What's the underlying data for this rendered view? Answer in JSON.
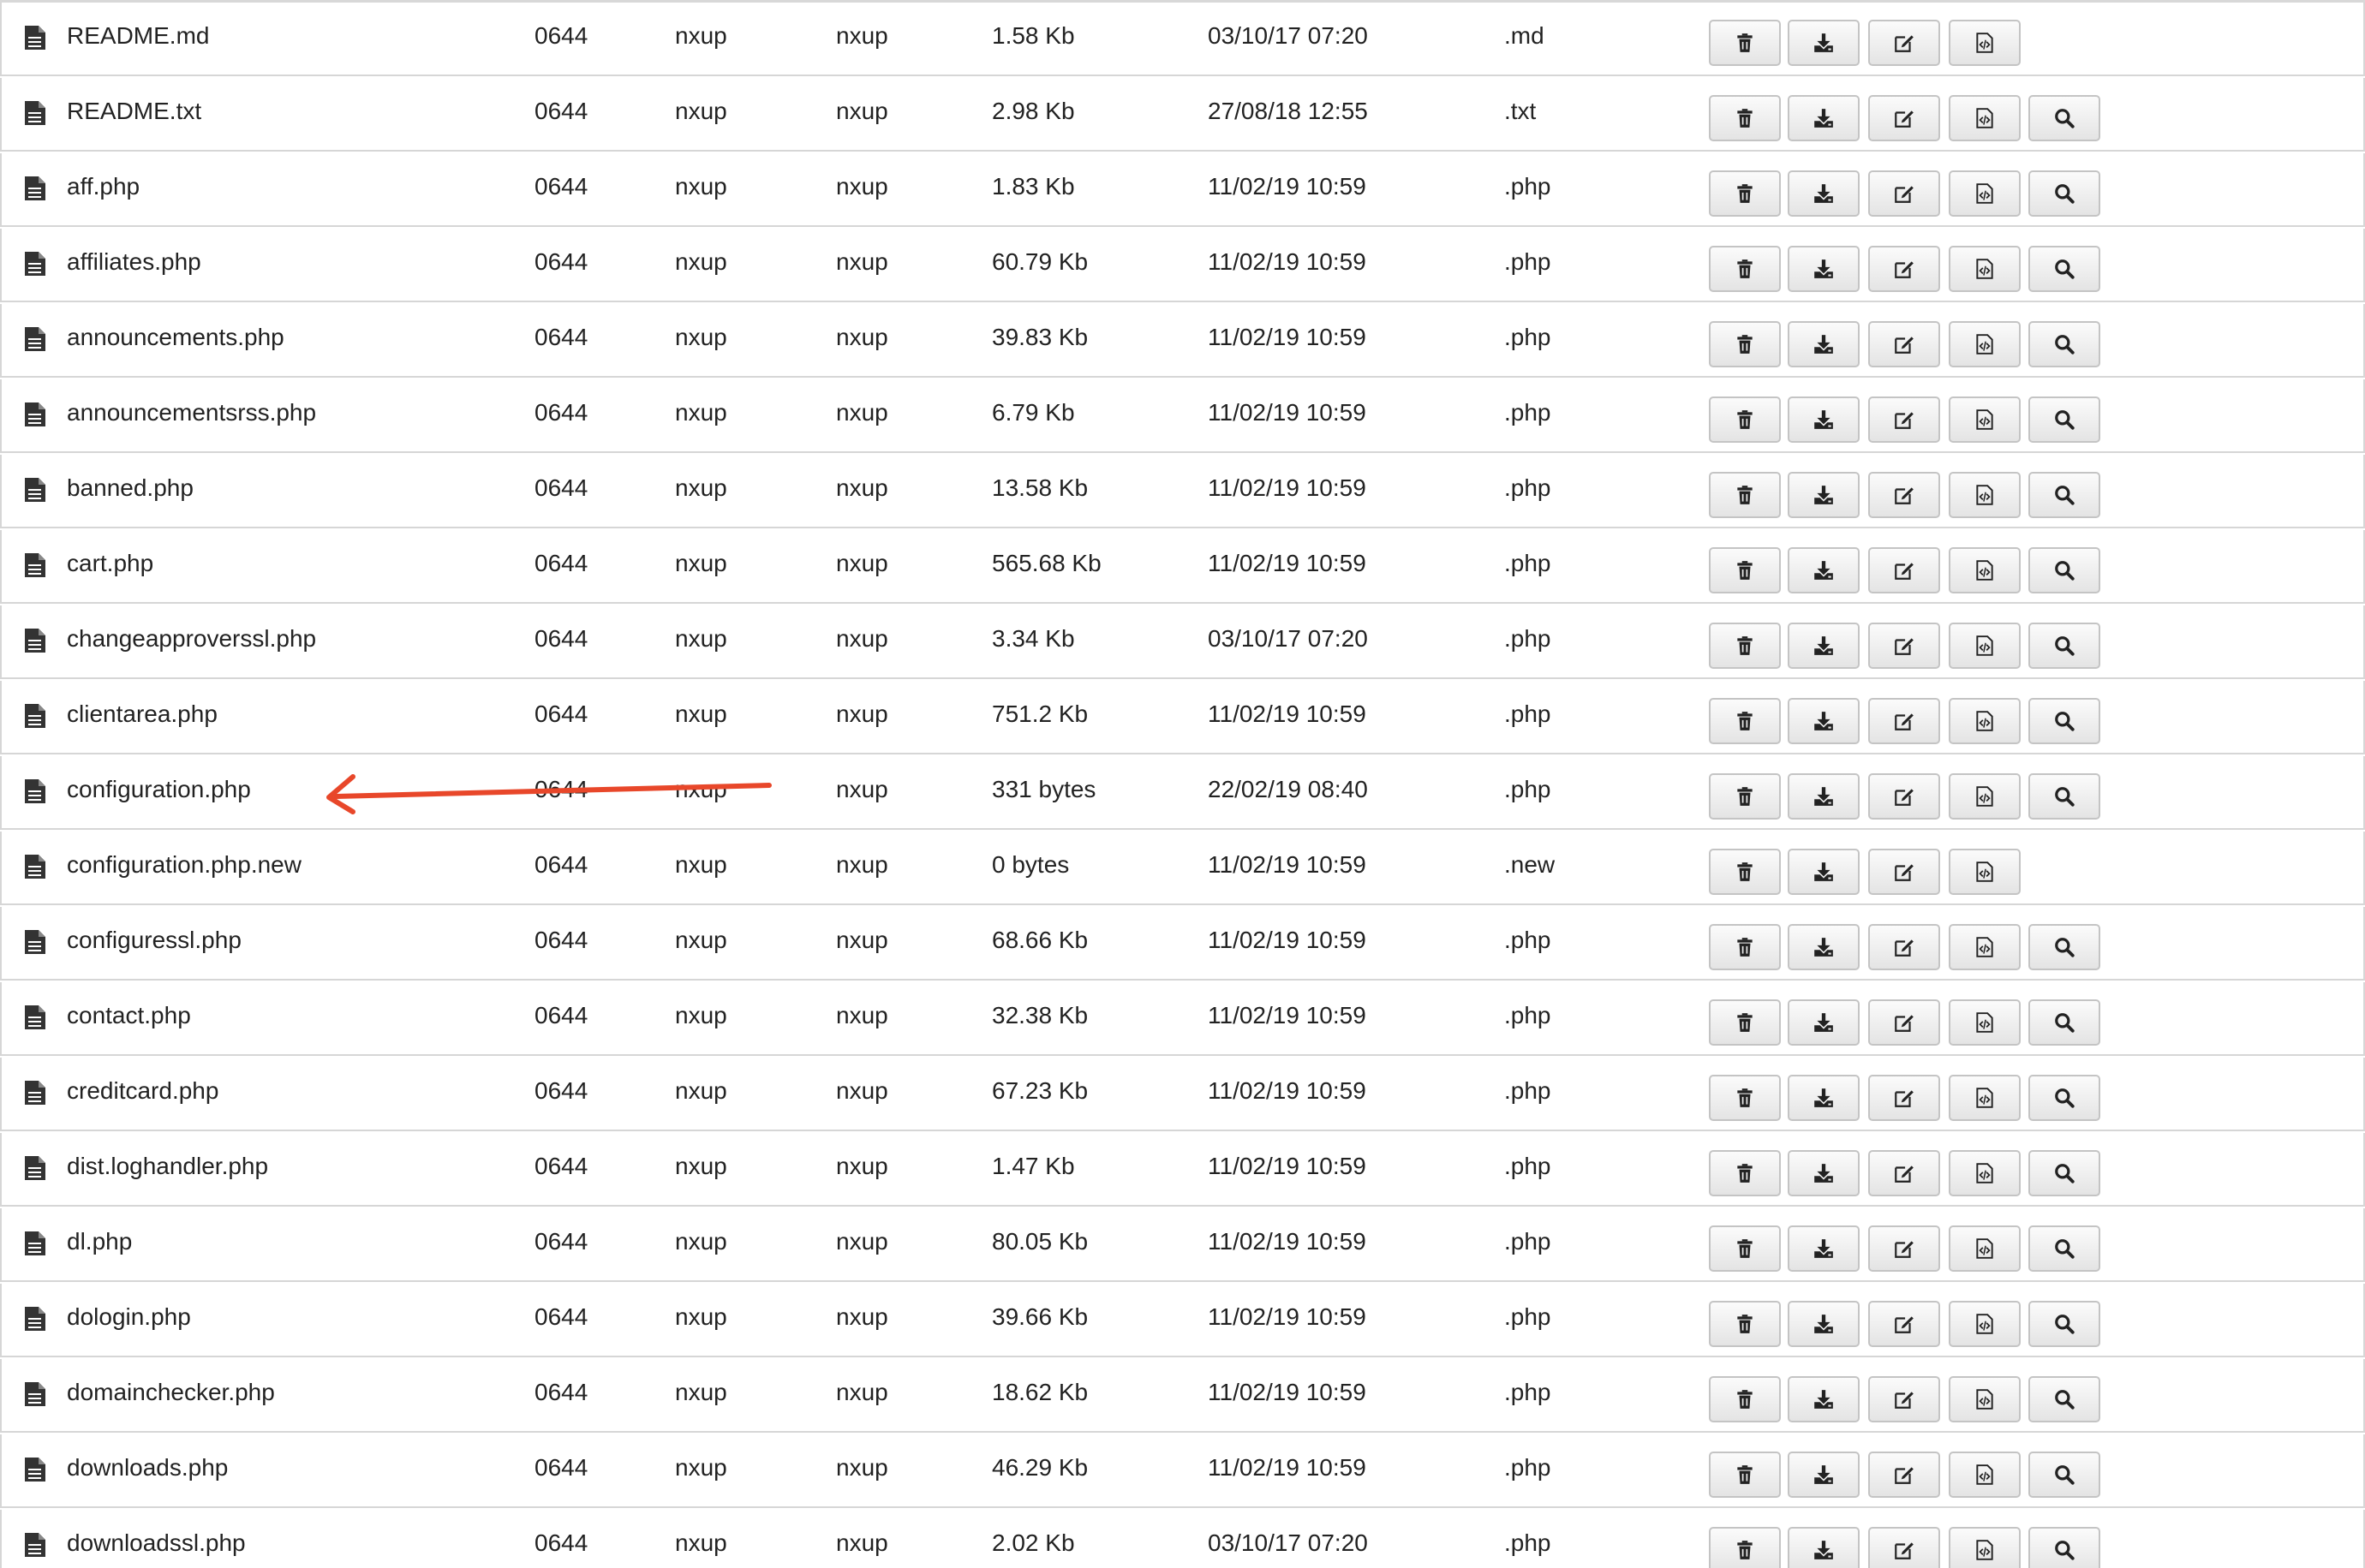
{
  "files": [
    {
      "name": "README.md",
      "perms": "0644",
      "owner": "nxup",
      "group": "nxup",
      "size": "1.58 Kb",
      "modified": "03/10/17 07:20",
      "ext": ".md",
      "has_view": false
    },
    {
      "name": "README.txt",
      "perms": "0644",
      "owner": "nxup",
      "group": "nxup",
      "size": "2.98 Kb",
      "modified": "27/08/18 12:55",
      "ext": ".txt",
      "has_view": true
    },
    {
      "name": "aff.php",
      "perms": "0644",
      "owner": "nxup",
      "group": "nxup",
      "size": "1.83 Kb",
      "modified": "11/02/19 10:59",
      "ext": ".php",
      "has_view": true
    },
    {
      "name": "affiliates.php",
      "perms": "0644",
      "owner": "nxup",
      "group": "nxup",
      "size": "60.79 Kb",
      "modified": "11/02/19 10:59",
      "ext": ".php",
      "has_view": true
    },
    {
      "name": "announcements.php",
      "perms": "0644",
      "owner": "nxup",
      "group": "nxup",
      "size": "39.83 Kb",
      "modified": "11/02/19 10:59",
      "ext": ".php",
      "has_view": true
    },
    {
      "name": "announcementsrss.php",
      "perms": "0644",
      "owner": "nxup",
      "group": "nxup",
      "size": "6.79 Kb",
      "modified": "11/02/19 10:59",
      "ext": ".php",
      "has_view": true
    },
    {
      "name": "banned.php",
      "perms": "0644",
      "owner": "nxup",
      "group": "nxup",
      "size": "13.58 Kb",
      "modified": "11/02/19 10:59",
      "ext": ".php",
      "has_view": true
    },
    {
      "name": "cart.php",
      "perms": "0644",
      "owner": "nxup",
      "group": "nxup",
      "size": "565.68 Kb",
      "modified": "11/02/19 10:59",
      "ext": ".php",
      "has_view": true
    },
    {
      "name": "changeapproverssl.php",
      "perms": "0644",
      "owner": "nxup",
      "group": "nxup",
      "size": "3.34 Kb",
      "modified": "03/10/17 07:20",
      "ext": ".php",
      "has_view": true
    },
    {
      "name": "clientarea.php",
      "perms": "0644",
      "owner": "nxup",
      "group": "nxup",
      "size": "751.2 Kb",
      "modified": "11/02/19 10:59",
      "ext": ".php",
      "has_view": true
    },
    {
      "name": "configuration.php",
      "perms": "0644",
      "owner": "nxup",
      "group": "nxup",
      "size": "331 bytes",
      "modified": "22/02/19 08:40",
      "ext": ".php",
      "has_view": true
    },
    {
      "name": "configuration.php.new",
      "perms": "0644",
      "owner": "nxup",
      "group": "nxup",
      "size": "0 bytes",
      "modified": "11/02/19 10:59",
      "ext": ".new",
      "has_view": false
    },
    {
      "name": "configuressl.php",
      "perms": "0644",
      "owner": "nxup",
      "group": "nxup",
      "size": "68.66 Kb",
      "modified": "11/02/19 10:59",
      "ext": ".php",
      "has_view": true
    },
    {
      "name": "contact.php",
      "perms": "0644",
      "owner": "nxup",
      "group": "nxup",
      "size": "32.38 Kb",
      "modified": "11/02/19 10:59",
      "ext": ".php",
      "has_view": true
    },
    {
      "name": "creditcard.php",
      "perms": "0644",
      "owner": "nxup",
      "group": "nxup",
      "size": "67.23 Kb",
      "modified": "11/02/19 10:59",
      "ext": ".php",
      "has_view": true
    },
    {
      "name": "dist.loghandler.php",
      "perms": "0644",
      "owner": "nxup",
      "group": "nxup",
      "size": "1.47 Kb",
      "modified": "11/02/19 10:59",
      "ext": ".php",
      "has_view": true
    },
    {
      "name": "dl.php",
      "perms": "0644",
      "owner": "nxup",
      "group": "nxup",
      "size": "80.05 Kb",
      "modified": "11/02/19 10:59",
      "ext": ".php",
      "has_view": true
    },
    {
      "name": "dologin.php",
      "perms": "0644",
      "owner": "nxup",
      "group": "nxup",
      "size": "39.66 Kb",
      "modified": "11/02/19 10:59",
      "ext": ".php",
      "has_view": true
    },
    {
      "name": "domainchecker.php",
      "perms": "0644",
      "owner": "nxup",
      "group": "nxup",
      "size": "18.62 Kb",
      "modified": "11/02/19 10:59",
      "ext": ".php",
      "has_view": true
    },
    {
      "name": "downloads.php",
      "perms": "0644",
      "owner": "nxup",
      "group": "nxup",
      "size": "46.29 Kb",
      "modified": "11/02/19 10:59",
      "ext": ".php",
      "has_view": true
    },
    {
      "name": "downloadssl.php",
      "perms": "0644",
      "owner": "nxup",
      "group": "nxup",
      "size": "2.02 Kb",
      "modified": "03/10/17 07:20",
      "ext": ".php",
      "has_view": true
    }
  ],
  "icons": {
    "file": "file-icon",
    "delete": "trash-icon",
    "download": "download-icon",
    "edit": "edit-icon",
    "code": "code-file-icon",
    "view": "search-icon"
  },
  "annotation": {
    "arrow_color": "#e8472a",
    "points_to": "configuration.php"
  }
}
